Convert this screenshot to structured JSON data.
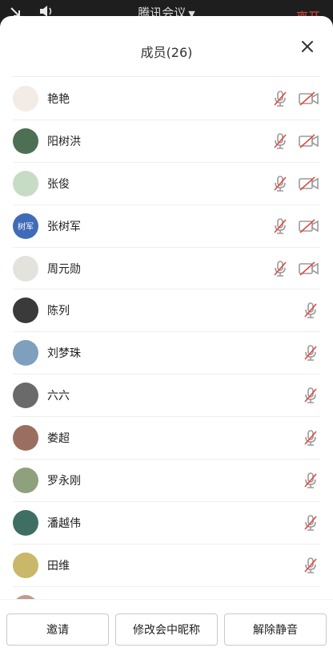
{
  "topbar": {
    "title": "腾讯会议",
    "leave_label": "离开"
  },
  "panel": {
    "title": "成员(26)"
  },
  "members": [
    {
      "name": "艳艳",
      "avatar_color": "#f3ece6",
      "avatar_text": "",
      "mic_muted": true,
      "camera_off": true
    },
    {
      "name": "阳树洪",
      "avatar_color": "#4d7054",
      "avatar_text": "",
      "mic_muted": true,
      "camera_off": true
    },
    {
      "name": "张俊",
      "avatar_color": "#c7dcc4",
      "avatar_text": "",
      "mic_muted": true,
      "camera_off": true
    },
    {
      "name": "张树军",
      "avatar_color": "#3f6bb7",
      "avatar_text": "树军",
      "mic_muted": true,
      "camera_off": true
    },
    {
      "name": "周元勋",
      "avatar_color": "#e4e2dc",
      "avatar_text": "",
      "mic_muted": true,
      "camera_off": true
    },
    {
      "name": "陈列",
      "avatar_color": "#3a3a3a",
      "avatar_text": "",
      "mic_muted": true,
      "camera_off": false
    },
    {
      "name": "刘梦珠",
      "avatar_color": "#7f9fbf",
      "avatar_text": "",
      "mic_muted": true,
      "camera_off": false
    },
    {
      "name": "六六",
      "avatar_color": "#6a6a6a",
      "avatar_text": "",
      "mic_muted": true,
      "camera_off": false
    },
    {
      "name": "娄超",
      "avatar_color": "#9a6f61",
      "avatar_text": "",
      "mic_muted": true,
      "camera_off": false
    },
    {
      "name": "罗永刚",
      "avatar_color": "#8fa07d",
      "avatar_text": "",
      "mic_muted": true,
      "camera_off": false
    },
    {
      "name": "潘越伟",
      "avatar_color": "#3f6f63",
      "avatar_text": "",
      "mic_muted": true,
      "camera_off": false
    },
    {
      "name": "田维",
      "avatar_color": "#c9b76a",
      "avatar_text": "",
      "mic_muted": true,
      "camera_off": false
    },
    {
      "name": "",
      "avatar_color": "#c29a8f",
      "avatar_text": "",
      "mic_muted": true,
      "camera_off": false
    }
  ],
  "footer": {
    "invite_label": "邀请",
    "rename_label": "修改会中昵称",
    "unmute_label": "解除静音"
  },
  "colors": {
    "mute_red": "#e5463c",
    "icon_gray": "#9a9a9a"
  }
}
